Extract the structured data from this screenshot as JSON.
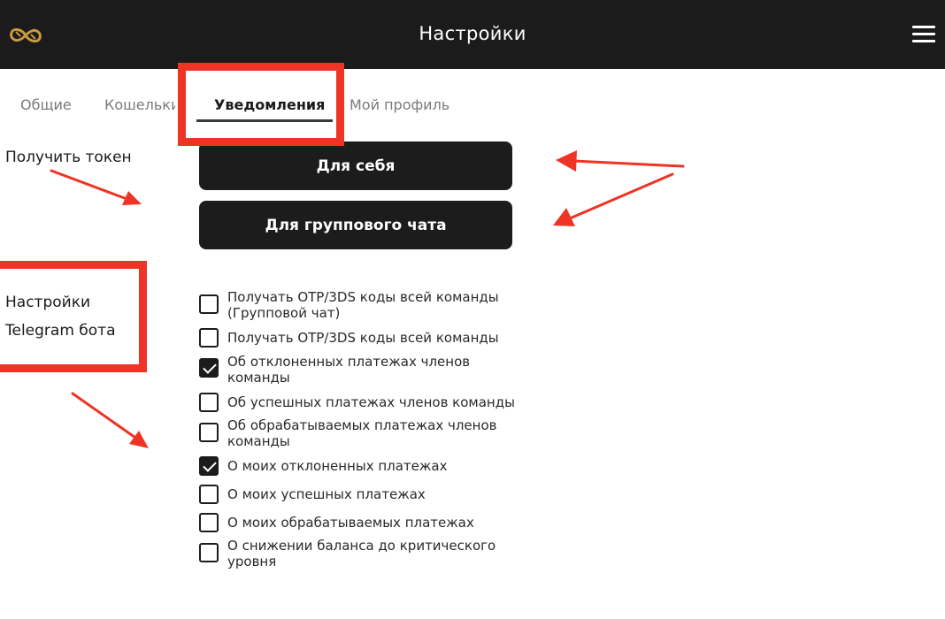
{
  "header": {
    "title": "Настройки",
    "logo_icon": "infinity-logo-icon",
    "menu_icon": "hamburger-menu-icon"
  },
  "tabs": [
    {
      "label": "Общие",
      "active": false
    },
    {
      "label": "Кошельки",
      "active": false
    },
    {
      "label": "Уведомления",
      "active": true
    },
    {
      "label": "Мой профиль",
      "active": false
    }
  ],
  "sections": {
    "token_label": "Получить токен",
    "settings_label_line1": "Настройки",
    "settings_label_line2": "Telegram бота"
  },
  "buttons": {
    "self": "Для себя",
    "group_chat": "Для группового чата"
  },
  "checkboxes": [
    {
      "line1": "Получать OTP/3DS коды всей команды",
      "line2": "(Групповой чат)",
      "checked": false
    },
    {
      "line1": "Получать OTP/3DS коды всей команды",
      "line2": "",
      "checked": false
    },
    {
      "line1": "Об отклоненных платежах членов",
      "line2": "команды",
      "checked": true
    },
    {
      "line1": "Об успешных платежах членов команды",
      "line2": "",
      "checked": false
    },
    {
      "line1": "Об обрабатываемых платежах членов",
      "line2": "команды",
      "checked": false
    },
    {
      "line1": "О моих отклоненных платежах",
      "line2": "",
      "checked": true
    },
    {
      "line1": "О моих успешных платежах",
      "line2": "",
      "checked": false
    },
    {
      "line1": "О моих обрабатываемых платежах",
      "line2": "",
      "checked": false
    },
    {
      "line1": "О снижении баланса до критического",
      "line2": "уровня",
      "checked": false
    }
  ],
  "colors": {
    "header_bg": "#1b1b1b",
    "logo_gold": "#c9993f",
    "annotation_red": "#ee3425",
    "button_bg": "#1c1c1c"
  }
}
